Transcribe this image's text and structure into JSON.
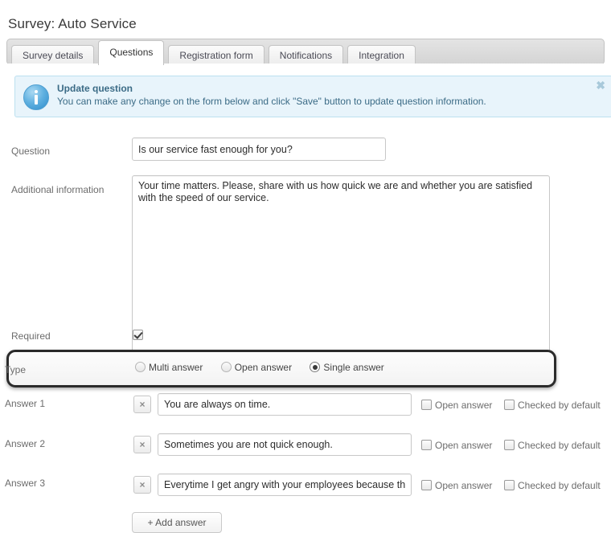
{
  "page": {
    "title": "Survey: Auto Service"
  },
  "tabs": [
    {
      "label": "Survey details",
      "active": false
    },
    {
      "label": "Questions",
      "active": true
    },
    {
      "label": "Registration form",
      "active": false
    },
    {
      "label": "Notifications",
      "active": false
    },
    {
      "label": "Integration",
      "active": false
    }
  ],
  "alert": {
    "icon": "info-icon",
    "title": "Update question",
    "text": "You can make any change on the form below and click \"Save\" button to update question information.",
    "close_label": "✖",
    "background_color": "#e8f4fb",
    "border_color": "#bce0f0",
    "text_color": "#3b6b86"
  },
  "form": {
    "question": {
      "label": "Question",
      "value": "Is our service fast enough for you?",
      "placeholder": ""
    },
    "additional_information": {
      "label": "Additional information",
      "value": "Your time matters. Please, share with us how quick we are and whether you are satisfied with the speed of our service.",
      "placeholder": ""
    },
    "required": {
      "label": "Required",
      "checked": true
    },
    "type": {
      "label": "Type",
      "options": [
        {
          "label": "Multi answer",
          "selected": false
        },
        {
          "label": "Open answer",
          "selected": false
        },
        {
          "label": "Single answer",
          "selected": true
        }
      ]
    },
    "answers": [
      {
        "label": "Answer 1",
        "value": "You are always on time.",
        "delete_label": "×",
        "open_answer_label": "Open answer",
        "open_answer_checked": false,
        "checked_by_default_label": "Checked by default",
        "checked_by_default_checked": false
      },
      {
        "label": "Answer 2",
        "value": "Sometimes you are not quick enough.",
        "delete_label": "×",
        "open_answer_label": "Open answer",
        "open_answer_checked": false,
        "checked_by_default_label": "Checked by default",
        "checked_by_default_checked": false
      },
      {
        "label": "Answer 3",
        "value": "Everytime I get angry with your employees because they are so slow.",
        "delete_label": "×",
        "open_answer_label": "Open answer",
        "open_answer_checked": false,
        "checked_by_default_label": "Checked by default",
        "checked_by_default_checked": false
      }
    ],
    "add_answer_button": "+ Add answer"
  }
}
